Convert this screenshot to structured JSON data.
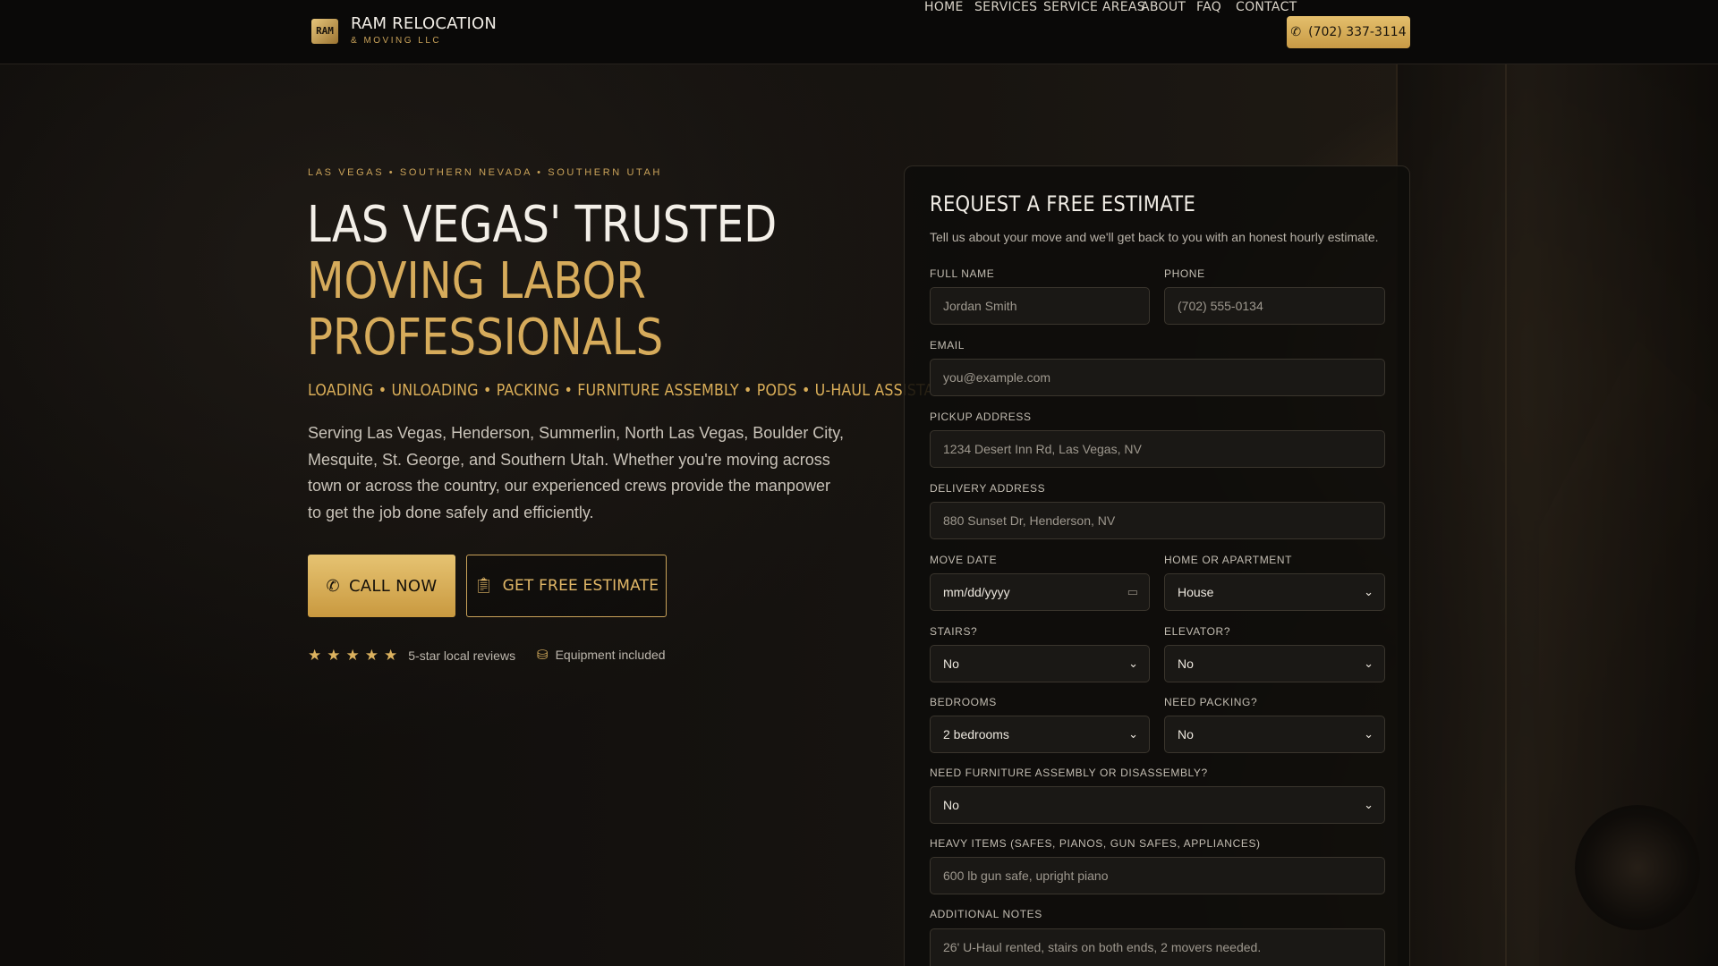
{
  "brand": {
    "logo_mark": "RAM",
    "title": "RAM RELOCATION",
    "subtitle": "& MOVING LLC"
  },
  "nav": {
    "items": [
      "HOME",
      "SERVICES",
      "SERVICE AREAS",
      "ABOUT",
      "FAQ",
      "CONTACT"
    ],
    "phone_label": "(702) 337-3114"
  },
  "hero": {
    "eyebrow": "LAS VEGAS • SOUTHERN NEVADA • SOUTHERN UTAH",
    "title_line1": "LAS VEGAS' TRUSTED",
    "title_line2": "MOVING LABOR",
    "title_line3": "PROFESSIONALS",
    "services": "LOADING • UNLOADING • PACKING • FURNITURE ASSEMBLY • PODS • U-HAUL ASSISTANCE",
    "description": "Serving Las Vegas, Henderson, Summerlin, North Las Vegas, Boulder City, Mesquite, St. George, and Southern Utah. Whether you're moving across town or across the country, our experienced crews provide the manpower to get the job done safely and efficiently.",
    "call_button": "CALL NOW",
    "estimate_button": "GET FREE ESTIMATE",
    "rating_text": "5-star local reviews",
    "stars": 5,
    "equipment_text": "Equipment included"
  },
  "form": {
    "title": "REQUEST A FREE ESTIMATE",
    "subtitle": "Tell us about your move and we'll get back to you with an honest hourly estimate.",
    "full_name": {
      "label": "FULL NAME",
      "placeholder": "Jordan Smith"
    },
    "phone": {
      "label": "PHONE",
      "placeholder": "(702) 555-0134"
    },
    "email": {
      "label": "EMAIL",
      "placeholder": "you@example.com"
    },
    "pickup": {
      "label": "PICKUP ADDRESS",
      "placeholder": "1234 Desert Inn Rd, Las Vegas, NV"
    },
    "delivery": {
      "label": "DELIVERY ADDRESS",
      "placeholder": "880 Sunset Dr, Henderson, NV"
    },
    "move_date": {
      "label": "MOVE DATE",
      "value": "mm/dd/yyyy"
    },
    "home_type": {
      "label": "HOME OR APARTMENT",
      "value": "House"
    },
    "stairs": {
      "label": "STAIRS?",
      "value": "No"
    },
    "elevator": {
      "label": "ELEVATOR?",
      "value": "No"
    },
    "bedrooms": {
      "label": "BEDROOMS",
      "value": "2 bedrooms"
    },
    "packing": {
      "label": "NEED PACKING?",
      "value": "No"
    },
    "assembly": {
      "label": "NEED FURNITURE ASSEMBLY OR DISASSEMBLY?",
      "value": "No"
    },
    "heavy": {
      "label": "HEAVY ITEMS (SAFES, PIANOS, GUN SAFES, APPLIANCES)",
      "placeholder": "600 lb gun safe, upright piano"
    },
    "notes": {
      "label": "ADDITIONAL NOTES",
      "placeholder": "26' U-Haul rented, stairs on both ends, 2 movers needed."
    }
  },
  "colors": {
    "accent_gold": "#d6ab5b",
    "background": "#0b0a09",
    "card": "#0e0c0a"
  }
}
